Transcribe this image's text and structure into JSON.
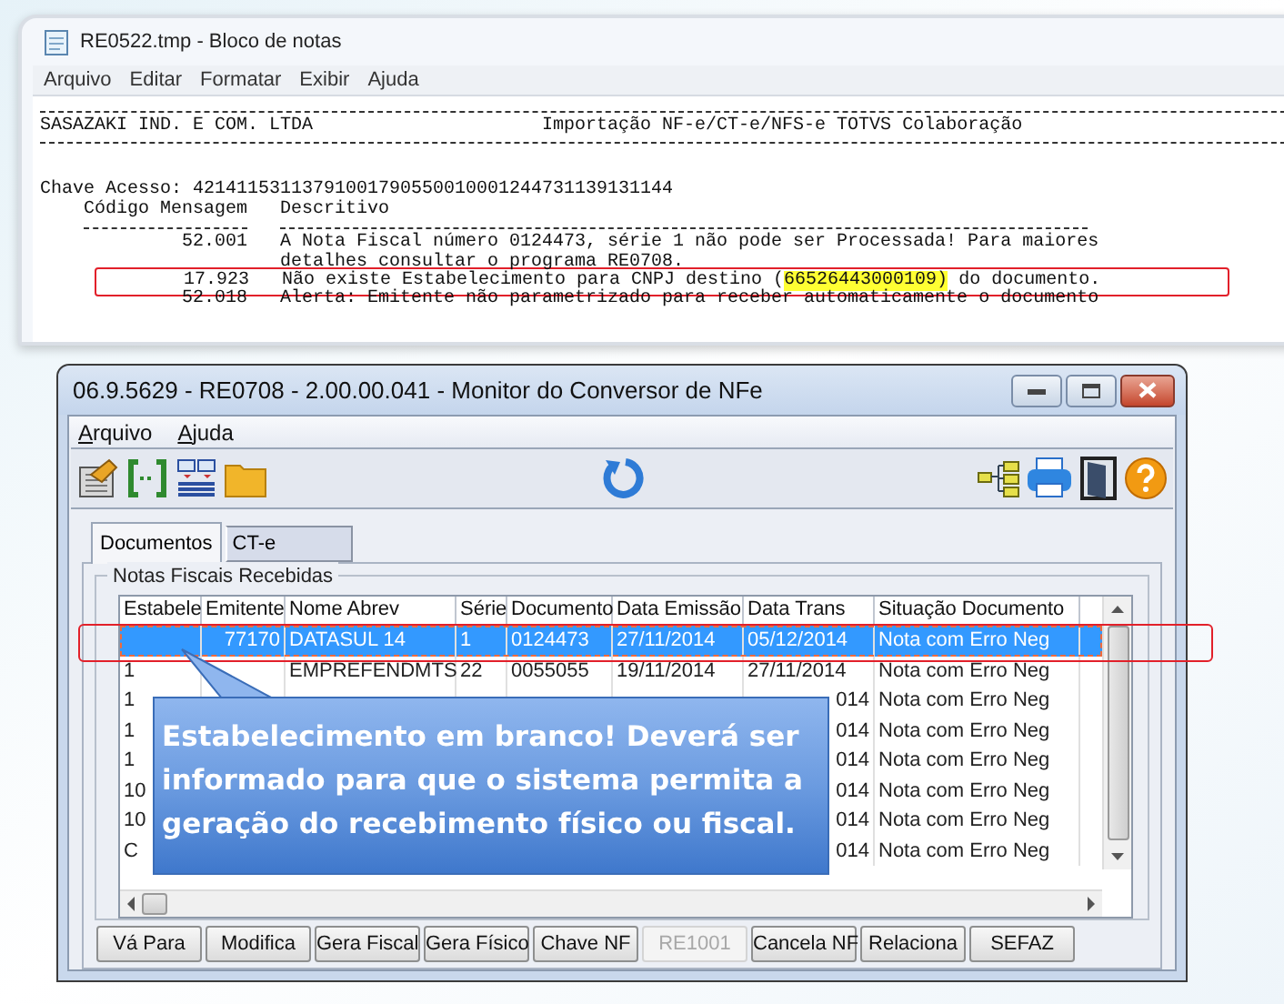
{
  "notepad": {
    "title": "RE0522.tmp - Bloco de notas",
    "menu": [
      "Arquivo",
      "Editar",
      "Formatar",
      "Exibir",
      "Ajuda"
    ],
    "company": "SASAZAKI IND. E COM. LTDA",
    "report_title": "Importação NF-e/CT-e/NFS-e TOTVS Colaboração",
    "access_key": "Chave Acesso: 42141153113791001790550010001244731139131144",
    "columns": [
      "Código Mensagem",
      "Descritivo"
    ],
    "messages": [
      {
        "code": "52.001",
        "parts": [
          {
            "text": "A Nota Fiscal número 0124473, série 1 não pode ser Processada! Para maiores",
            "marked": false
          }
        ],
        "highlighted": false
      },
      {
        "parts": [
          {
            "text": "detalhes consultar o programa RE0708.",
            "marked": false
          }
        ],
        "highlighted": false
      },
      {
        "code": "17.923",
        "parts": [
          {
            "text": "Não existe Estabelecimento para CNPJ destino (",
            "marked": false
          },
          {
            "text": "66526443000109)",
            "marked": true
          },
          {
            "text": " do documento.",
            "marked": false
          }
        ],
        "highlighted": true
      },
      {
        "code": "52.018",
        "parts": [
          {
            "text": "Alerta: Emitente não parametrizado para receber automaticamente o documento",
            "marked": false
          }
        ],
        "highlighted": false
      }
    ]
  },
  "monitor": {
    "title": "06.9.5629 - RE0708 - 2.00.00.041 - Monitor do Conversor de NFe",
    "menu": [
      "Arquivo",
      "Ajuda"
    ],
    "tabs": [
      {
        "label": "Documentos",
        "selected": true
      },
      {
        "label": "CT-e",
        "selected": false
      }
    ],
    "group_title": "Notas Fiscais Recebidas",
    "table": {
      "columns": [
        "Estabele",
        "Emitente",
        "Nome Abrev",
        "Série",
        "Documento",
        "Data Emissão",
        "Data Trans",
        "Situação Documento"
      ],
      "rows": [
        {
          "selected": true,
          "cells": [
            null,
            "77170",
            "DATASUL 14",
            "1",
            "0124473",
            "27/11/2014",
            "05/12/2014",
            "Nota com Erro Neg"
          ]
        },
        {
          "selected": false,
          "cells": [
            "1",
            null,
            "EMPREFENDMTS",
            "22",
            "0055055",
            "19/11/2014",
            "27/11/2014",
            "Nota com Erro Neg"
          ]
        },
        {
          "selected": false,
          "cells": [
            "1",
            null,
            null,
            null,
            null,
            null,
            "014",
            "Nota com Erro Neg"
          ]
        },
        {
          "selected": false,
          "cells": [
            "1",
            null,
            null,
            null,
            null,
            null,
            "014",
            "Nota com Erro Neg"
          ]
        },
        {
          "selected": false,
          "cells": [
            "1",
            null,
            null,
            null,
            null,
            null,
            "014",
            "Nota com Erro Neg"
          ]
        },
        {
          "selected": false,
          "cells": [
            "10",
            null,
            null,
            null,
            null,
            null,
            "014",
            "Nota com Erro Neg"
          ]
        },
        {
          "selected": false,
          "cells": [
            "10",
            null,
            null,
            null,
            null,
            null,
            "014",
            "Nota com Erro Neg"
          ]
        },
        {
          "selected": false,
          "cells": [
            "C",
            null,
            null,
            null,
            null,
            null,
            "014",
            "Nota com Erro Neg"
          ]
        }
      ]
    },
    "buttons": [
      {
        "label": "Vá Para",
        "disabled": false
      },
      {
        "label": "Modifica",
        "disabled": false
      },
      {
        "label": "Gera Fiscal",
        "disabled": false
      },
      {
        "label": "Gera Físico",
        "disabled": false
      },
      {
        "label": "Chave NF",
        "disabled": false
      },
      {
        "label": "RE1001",
        "disabled": true
      },
      {
        "label": "Cancela NF",
        "disabled": false
      },
      {
        "label": "Relaciona",
        "disabled": false
      },
      {
        "label": "SEFAZ",
        "disabled": false
      }
    ]
  },
  "callout": {
    "text": "Estabelecimento em branco! Deverá ser informado para que o sistema permita a geração do recebimento físico ou fiscal."
  }
}
